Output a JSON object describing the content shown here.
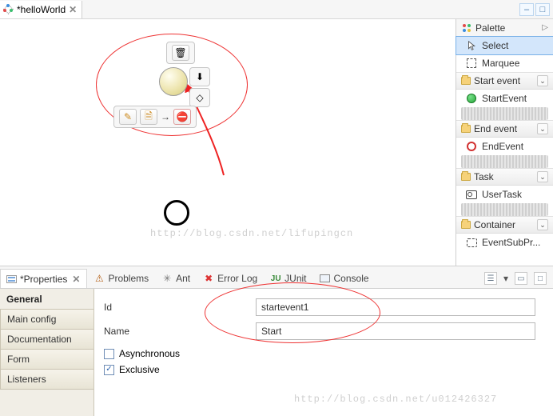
{
  "editor": {
    "tab_title": "*helloWorld",
    "close_glyph": "✕"
  },
  "window_controls": {
    "min": "–",
    "max": "□"
  },
  "palette": {
    "title": "Palette",
    "tools": {
      "select": "Select",
      "marquee": "Marquee"
    },
    "groups": {
      "start_event": {
        "label": "Start event",
        "items": {
          "start_event": "StartEvent"
        }
      },
      "end_event": {
        "label": "End event",
        "items": {
          "end_event": "EndEvent"
        }
      },
      "task": {
        "label": "Task",
        "items": {
          "user_task": "UserTask"
        }
      },
      "container": {
        "label": "Container",
        "items": {
          "event_subprocess": "EventSubPr..."
        }
      }
    }
  },
  "views": {
    "properties": "*Properties",
    "problems": "Problems",
    "ant": "Ant",
    "error_log": "Error Log",
    "junit": "JUnit",
    "console": "Console"
  },
  "prop": {
    "head": "General",
    "cats": {
      "main_config": "Main config",
      "documentation": "Documentation",
      "form": "Form",
      "listeners": "Listeners"
    },
    "fields": {
      "id_label": "Id",
      "id_value": "startevent1",
      "name_label": "Name",
      "name_value": "Start",
      "async_label": "Asynchronous",
      "exclusive_label": "Exclusive"
    }
  },
  "watermarks": {
    "w1": "http://blog.csdn.net/lifupingcn",
    "w2": "http://blog.csdn.net/u012426327"
  },
  "glyphs": {
    "tri_right": "▷",
    "chev_down": "⌄",
    "gear": "⚙",
    "trash": "🗑",
    "arrow_dn": "⬇",
    "rot": "◇",
    "pencil": "✎",
    "doc": "🗎",
    "arrow": "→",
    "forbid": "⛔",
    "check": "✓",
    "junit_label": "JU",
    "dropdown_tri": "▾",
    "min_rect": "▭"
  }
}
